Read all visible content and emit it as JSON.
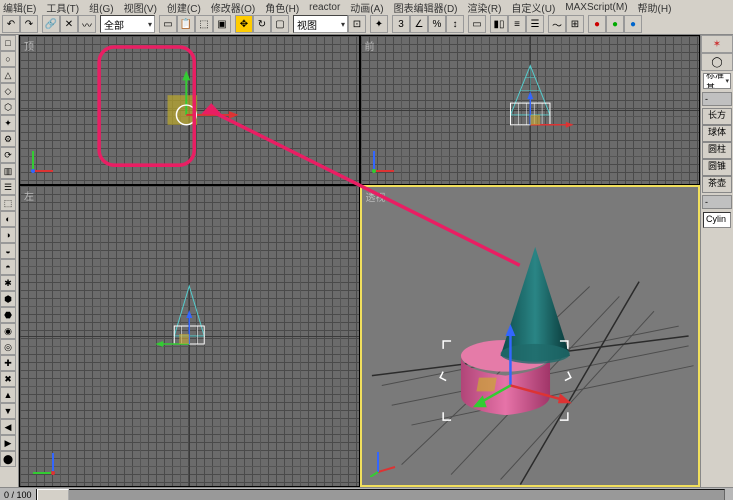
{
  "menu": {
    "items": [
      "编辑(E)",
      "工具(T)",
      "组(G)",
      "视图(V)",
      "创建(C)",
      "修改器(O)",
      "角色(H)",
      "reactor",
      "动画(A)",
      "图表编辑器(D)",
      "渲染(R)",
      "自定义(U)",
      "MAXScript(M)",
      "帮助(H)"
    ]
  },
  "toolbar": {
    "combo1": "全部",
    "combo2": "视图"
  },
  "viewports": {
    "top": "顶",
    "front": "前",
    "left": "左",
    "perspective": "透视"
  },
  "panel": {
    "category_label": "标准基",
    "object_buttons": [
      "长方",
      "球体",
      "圆柱",
      "圆锥",
      "茶壶"
    ],
    "rollout": "-",
    "name_value": "Cylin"
  },
  "timeline": {
    "frame_label": "0 / 100"
  },
  "colors": {
    "highlight_red": "#e91e63",
    "viewport_active": "#f2e05c",
    "cone": "#1a6b6b",
    "cylinder": "#d85a9a"
  }
}
